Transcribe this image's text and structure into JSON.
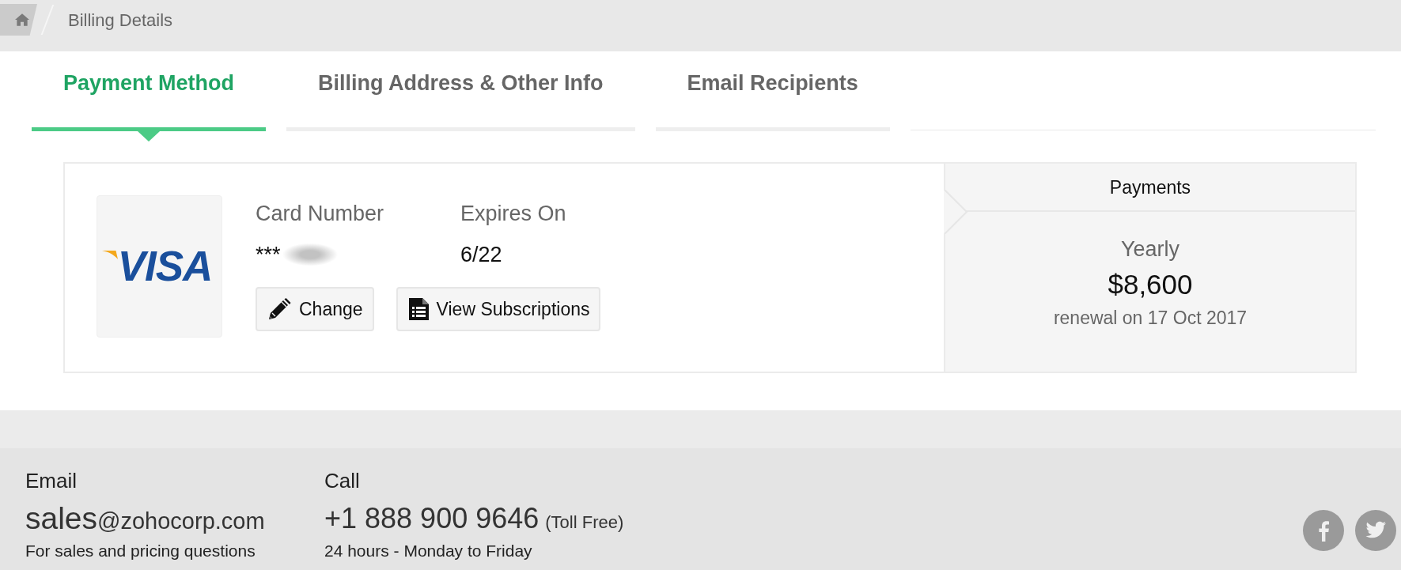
{
  "breadcrumb": {
    "current": "Billing Details"
  },
  "tabs": [
    {
      "label": "Payment Method",
      "selected": true
    },
    {
      "label": "Billing Address & Other Info",
      "selected": false
    },
    {
      "label": "Email Recipients",
      "selected": false
    }
  ],
  "card": {
    "brand": "VISA",
    "fields": [
      {
        "label": "Card Number",
        "value": "***",
        "redacted": true
      },
      {
        "label": "Expires On",
        "value": "6/22",
        "redacted": false
      }
    ],
    "buttons": [
      {
        "label": "Change",
        "kind": "edit"
      },
      {
        "label": "View Subscriptions",
        "kind": "list"
      }
    ]
  },
  "payments": {
    "title": "Payments",
    "cycle": "Yearly",
    "amount": "$8,600",
    "renewal": "renewal on 17 Oct 2017"
  },
  "footer": {
    "contacts": [
      {
        "kind": "email",
        "heading": "Email",
        "value": "sales@zohocorp.com",
        "detail": "For sales and pricing questions"
      },
      {
        "kind": "phone",
        "heading": "Call",
        "value": "+1 888 900 9646",
        "note": "(Toll Free)",
        "detail": "24 hours - Monday to Friday"
      }
    ],
    "social": [
      {
        "kind": "facebook"
      },
      {
        "kind": "twitter"
      }
    ]
  }
}
